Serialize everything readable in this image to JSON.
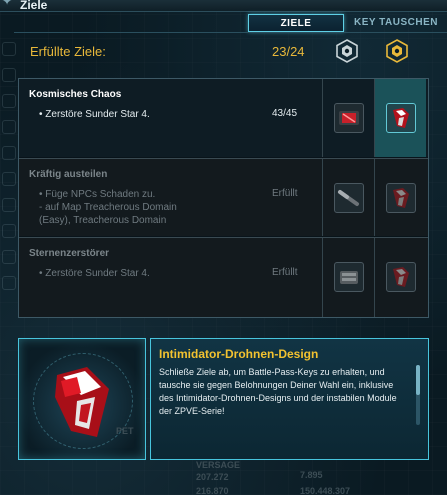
{
  "window": {
    "title": "Ziele"
  },
  "tabs": [
    {
      "label": "ZIELE",
      "active": true
    },
    {
      "label": "KEY TAUSCHEN",
      "active": false
    }
  ],
  "summary": {
    "label": "Erfüllte Ziele:",
    "count": "23/24",
    "icons": [
      "battle-pass-key-silver-icon",
      "battle-pass-key-gold-icon"
    ]
  },
  "objectives": [
    {
      "title": "Kosmisches Chaos",
      "desc": "• Zerstöre Sunder Star 4.",
      "status": "43/45",
      "active": true,
      "rewards": [
        "red-module-icon",
        "red-drone-design-icon"
      ]
    },
    {
      "title": "Kräftig austeilen",
      "desc": "• Füge NPCs Schaden zu.\n  - auf Map Treacherous Domain\n(Easy), Treacherous Domain",
      "status": "Erfüllt",
      "active": false,
      "rewards": [
        "weapon-barrel-icon",
        "red-drone-design-icon"
      ]
    },
    {
      "title": "Sternenzerstörer",
      "desc": "• Zerstöre Sunder Star 4.",
      "status": "Erfüllt",
      "active": false,
      "rewards": [
        "armor-plate-icon",
        "red-drone-design-icon"
      ]
    }
  ],
  "detail": {
    "title": "Intimidator-Drohnen-Design",
    "desc": "Schließe Ziele ab, um Battle-Pass-Keys zu erhalten, und tausche sie gegen Belohnungen Deiner Wahl ein, inklusive des Intimidator-Drohnen-Designs und der instabilen Module der ZPVE-Serie!",
    "image": "intimidator-drone-design-image"
  },
  "background": {
    "label_pet": "PET",
    "label_versage": "VERSAGE",
    "values": [
      "207.272",
      "216.870",
      "7.895",
      "150.448.307"
    ]
  },
  "colors": {
    "accent": "#48c5dd",
    "gold": "#e8b83a",
    "title_yellow": "#f2c230"
  }
}
